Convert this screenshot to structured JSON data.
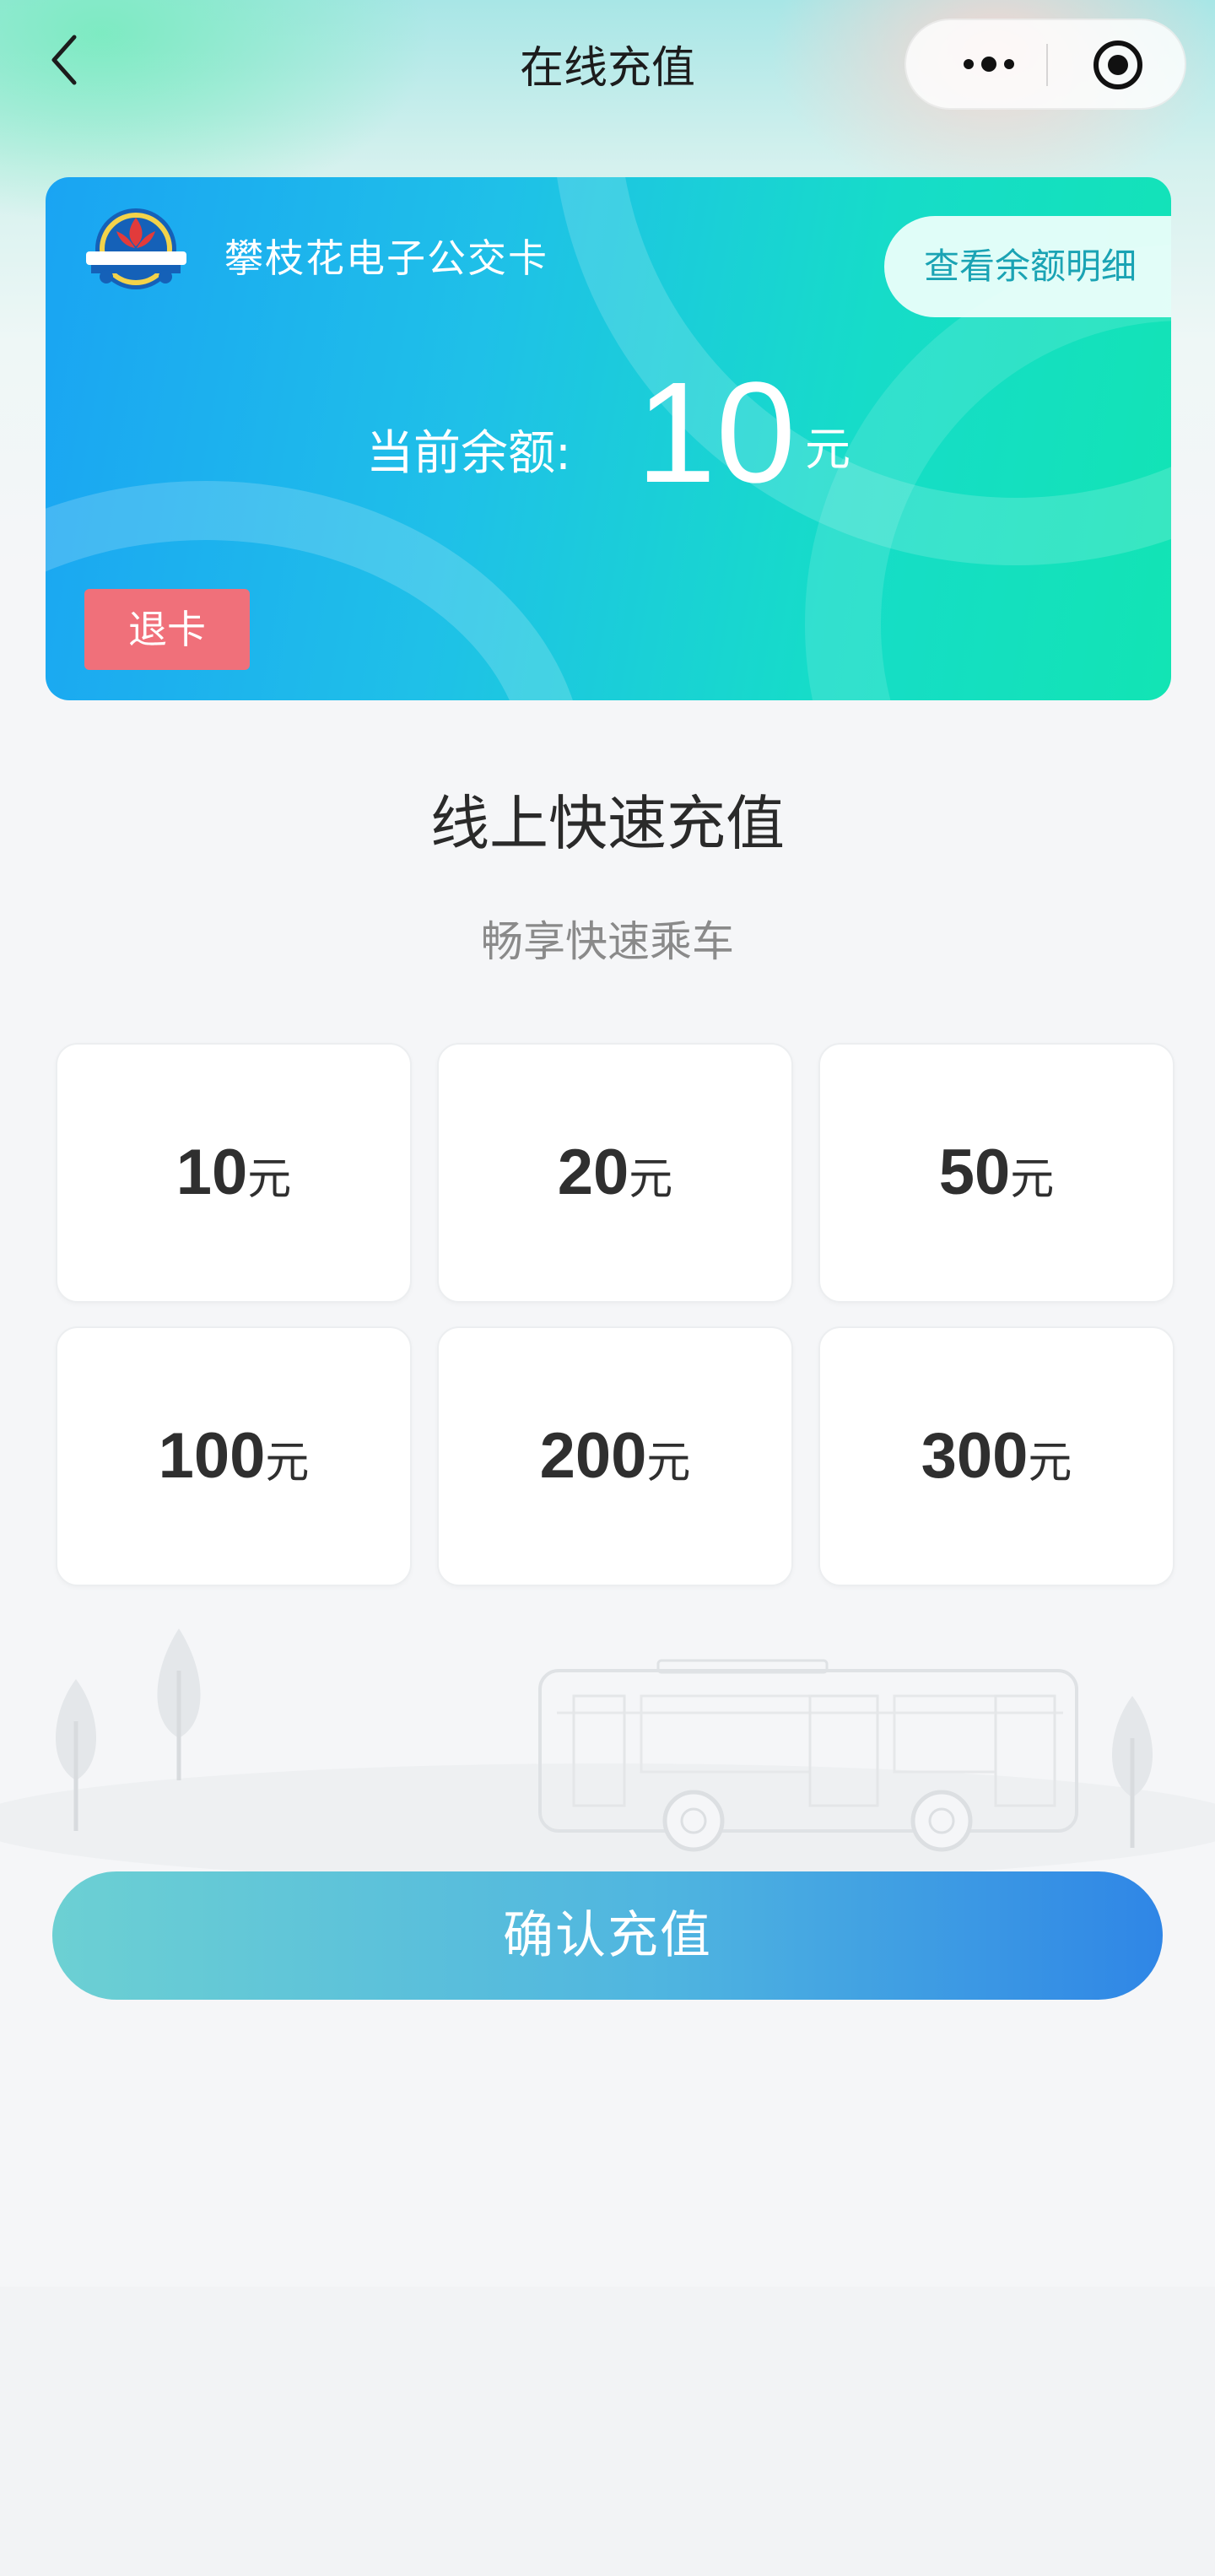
{
  "nav": {
    "title": "在线充值"
  },
  "card": {
    "name": "攀枝花电子公交卡",
    "detail_button": "查看余额明细",
    "balance_label": "当前余额:",
    "balance_value": "10",
    "balance_unit": "元",
    "refund_button": "退卡"
  },
  "section": {
    "title": "线上快速充值",
    "subtitle": "畅享快速乘车"
  },
  "amounts": [
    {
      "value": "10",
      "unit": "元"
    },
    {
      "value": "20",
      "unit": "元"
    },
    {
      "value": "50",
      "unit": "元"
    },
    {
      "value": "100",
      "unit": "元"
    },
    {
      "value": "200",
      "unit": "元"
    },
    {
      "value": "300",
      "unit": "元"
    }
  ],
  "confirm_button": "确认充值",
  "colors": {
    "card_gradient_start": "#1aa4f3",
    "card_gradient_end": "#12e4b4",
    "refund": "#f0707a",
    "confirm_start": "#6cd0d3",
    "confirm_end": "#2f86e6",
    "detail_text": "#1aa3b4"
  }
}
